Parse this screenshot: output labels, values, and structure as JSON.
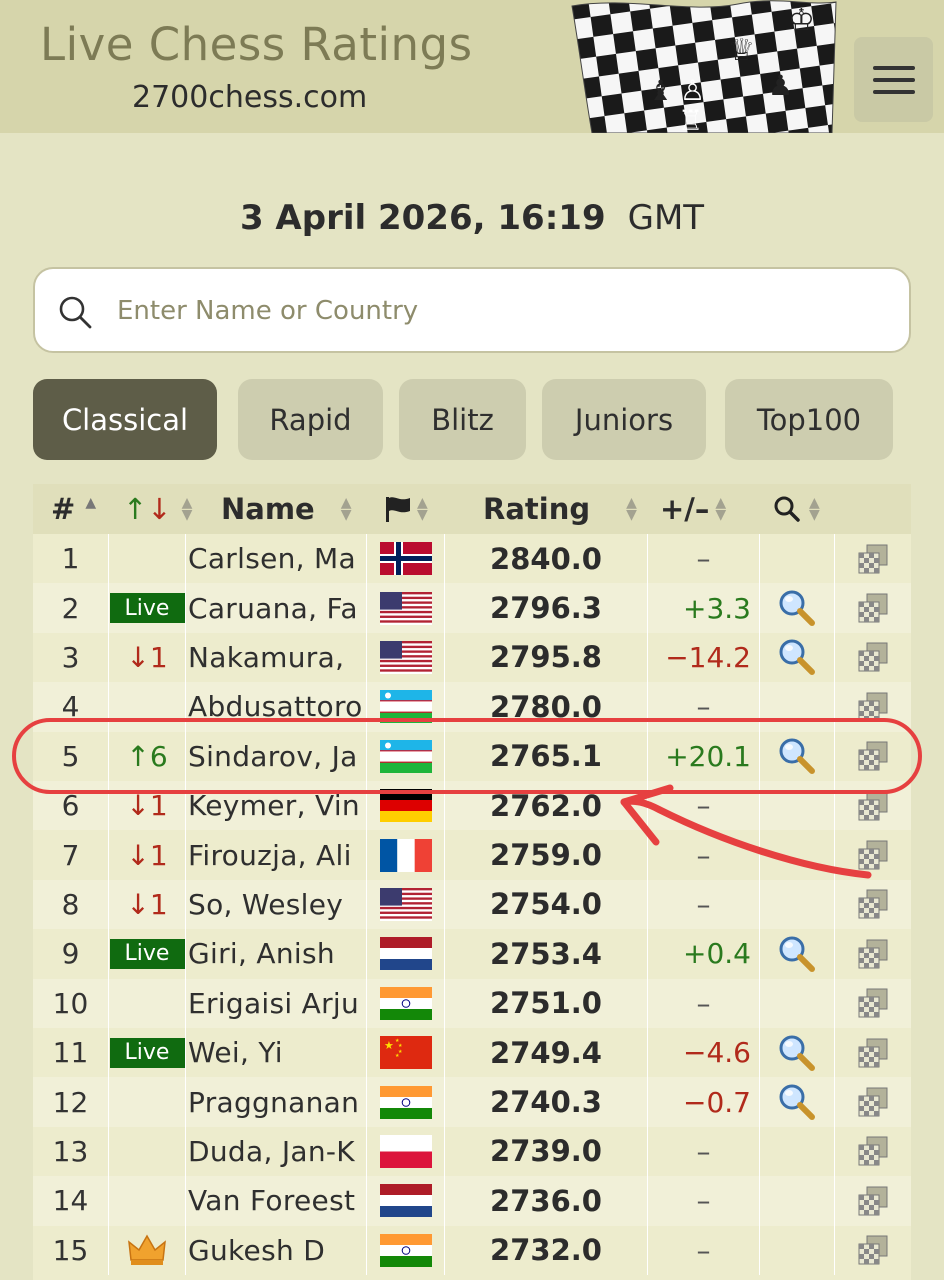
{
  "header": {
    "title": "Live Chess Ratings",
    "subtitle": "2700chess.com"
  },
  "date": {
    "main": "3 April 2026, 16:19",
    "tz": "GMT"
  },
  "search": {
    "placeholder": "Enter Name or Country"
  },
  "tabs": [
    {
      "label": "Classical",
      "active": true
    },
    {
      "label": "Rapid"
    },
    {
      "label": "Blitz"
    },
    {
      "label": "Juniors"
    },
    {
      "label": "Top100"
    }
  ],
  "table": {
    "headers": {
      "rank": "#",
      "change": "↑↓",
      "name": "Name",
      "rating": "Rating",
      "diff": "+/–"
    },
    "rows": [
      {
        "rank": "1",
        "change": "",
        "change_dir": "",
        "name": "Carlsen, Ma",
        "flag": "norway",
        "rating": "2840.0",
        "diff": "–",
        "diff_dir": "zero",
        "search": false
      },
      {
        "rank": "2",
        "change": "Live",
        "change_dir": "live",
        "name": "Caruana, Fa",
        "flag": "usa",
        "rating": "2796.3",
        "diff": "+3.3",
        "diff_dir": "up",
        "search": true
      },
      {
        "rank": "3",
        "change": "↓1",
        "change_dir": "down",
        "name": "Nakamura, ",
        "flag": "usa",
        "rating": "2795.8",
        "diff": "−14.2",
        "diff_dir": "down",
        "search": true
      },
      {
        "rank": "4",
        "change": "",
        "change_dir": "",
        "name": "Abdusattoro",
        "flag": "uzbekistan",
        "rating": "2780.0",
        "diff": "–",
        "diff_dir": "zero",
        "search": false
      },
      {
        "rank": "5",
        "change": "↑6",
        "change_dir": "up",
        "name": "Sindarov, Ja",
        "flag": "uzbekistan",
        "rating": "2765.1",
        "diff": "+20.1",
        "diff_dir": "up",
        "search": true
      },
      {
        "rank": "6",
        "change": "↓1",
        "change_dir": "down",
        "name": "Keymer, Vin",
        "flag": "germany",
        "rating": "2762.0",
        "diff": "–",
        "diff_dir": "zero",
        "search": false
      },
      {
        "rank": "7",
        "change": "↓1",
        "change_dir": "down",
        "name": "Firouzja, Ali",
        "flag": "france",
        "rating": "2759.0",
        "diff": "–",
        "diff_dir": "zero",
        "search": false
      },
      {
        "rank": "8",
        "change": "↓1",
        "change_dir": "down",
        "name": "So, Wesley",
        "flag": "usa",
        "rating": "2754.0",
        "diff": "–",
        "diff_dir": "zero",
        "search": false
      },
      {
        "rank": "9",
        "change": "Live",
        "change_dir": "live",
        "name": "Giri, Anish",
        "flag": "netherlands",
        "rating": "2753.4",
        "diff": "+0.4",
        "diff_dir": "up",
        "search": true
      },
      {
        "rank": "10",
        "change": "",
        "change_dir": "",
        "name": "Erigaisi Arju",
        "flag": "india",
        "rating": "2751.0",
        "diff": "–",
        "diff_dir": "zero",
        "search": false
      },
      {
        "rank": "11",
        "change": "Live",
        "change_dir": "live",
        "name": "Wei, Yi",
        "flag": "china",
        "rating": "2749.4",
        "diff": "−4.6",
        "diff_dir": "down",
        "search": true
      },
      {
        "rank": "12",
        "change": "",
        "change_dir": "",
        "name": "Praggnanan",
        "flag": "india",
        "rating": "2740.3",
        "diff": "−0.7",
        "diff_dir": "down",
        "search": true
      },
      {
        "rank": "13",
        "change": "",
        "change_dir": "",
        "name": "Duda, Jan-K",
        "flag": "poland",
        "rating": "2739.0",
        "diff": "–",
        "diff_dir": "zero",
        "search": false
      },
      {
        "rank": "14",
        "change": "",
        "change_dir": "",
        "name": "Van Foreest",
        "flag": "netherlands",
        "rating": "2736.0",
        "diff": "–",
        "diff_dir": "zero",
        "search": false
      },
      {
        "rank": "15",
        "change": "crown",
        "change_dir": "crown",
        "name": "Gukesh D",
        "flag": "india",
        "rating": "2732.0",
        "diff": "–",
        "diff_dir": "zero",
        "search": false
      }
    ]
  },
  "colors": {
    "background": "#e4e4c4",
    "header_bg": "#d6d5ab",
    "active_tab": "#5e5d48",
    "live_badge": "#106b10",
    "up": "#2a7a1e",
    "down": "#b12a1b",
    "annotation": "#e64040"
  }
}
